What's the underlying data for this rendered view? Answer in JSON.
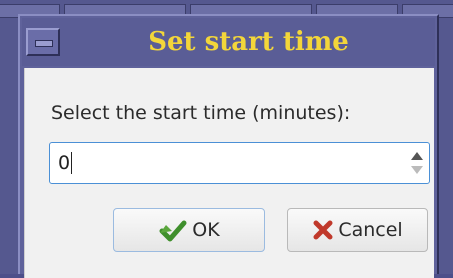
{
  "dialog": {
    "title": "Set start time",
    "prompt": "Select the start time (minutes):",
    "value": "0"
  },
  "buttons": {
    "ok_label": "OK",
    "cancel_label": "Cancel"
  },
  "icons": {
    "window_menu": "window-menu-icon",
    "ok": "green-check-arrow-icon",
    "cancel": "red-x-icon",
    "spin_up": "chevron-up-icon",
    "spin_down": "chevron-down-icon"
  },
  "colors": {
    "title_text": "#f3d63a",
    "frame": "#5a5d96",
    "focus_border": "#4b90d6"
  }
}
